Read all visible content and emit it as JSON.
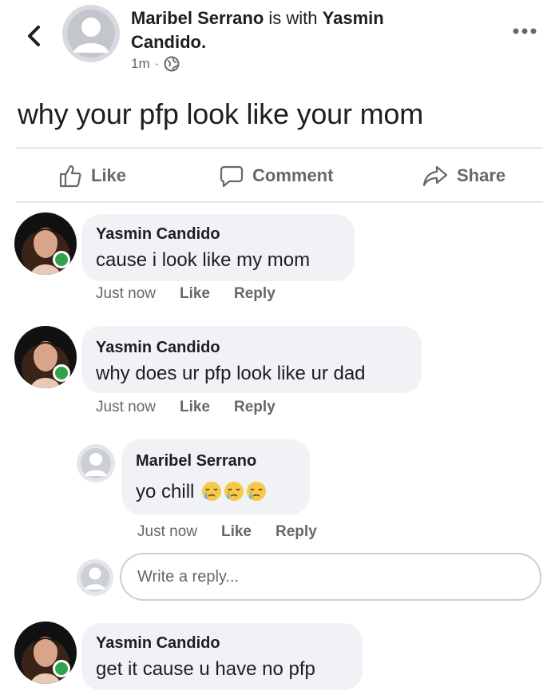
{
  "post": {
    "author": "Maribel Serrano",
    "with_text": "is with",
    "tagged_line1": "Yasmin",
    "tagged_line2": "Candido.",
    "time": "1m",
    "separator": "·",
    "privacy_icon": "globe-icon",
    "text": "why your pfp look like your mom"
  },
  "actions": {
    "like": "Like",
    "comment": "Comment",
    "share": "Share"
  },
  "comments": [
    {
      "author": "Yasmin Candido",
      "text": "cause i look like my mom",
      "time": "Just now",
      "like": "Like",
      "reply": "Reply"
    },
    {
      "author": "Yasmin Candido",
      "text": "why does ur pfp look like ur dad",
      "time": "Just now",
      "like": "Like",
      "reply": "Reply"
    },
    {
      "author": "Maribel Serrano",
      "text": "yo chill",
      "emoji": "crying-face-emoji",
      "time": "Just now",
      "like": "Like",
      "reply": "Reply"
    },
    {
      "author": "Yasmin Candido",
      "text": "get it cause u have no pfp"
    }
  ],
  "reply_box": {
    "placeholder": "Write a reply..."
  },
  "colors": {
    "secondary_text": "#65676b",
    "bubble": "#f0f2f5",
    "online": "#31a24c",
    "divider": "#e4e6eb"
  }
}
